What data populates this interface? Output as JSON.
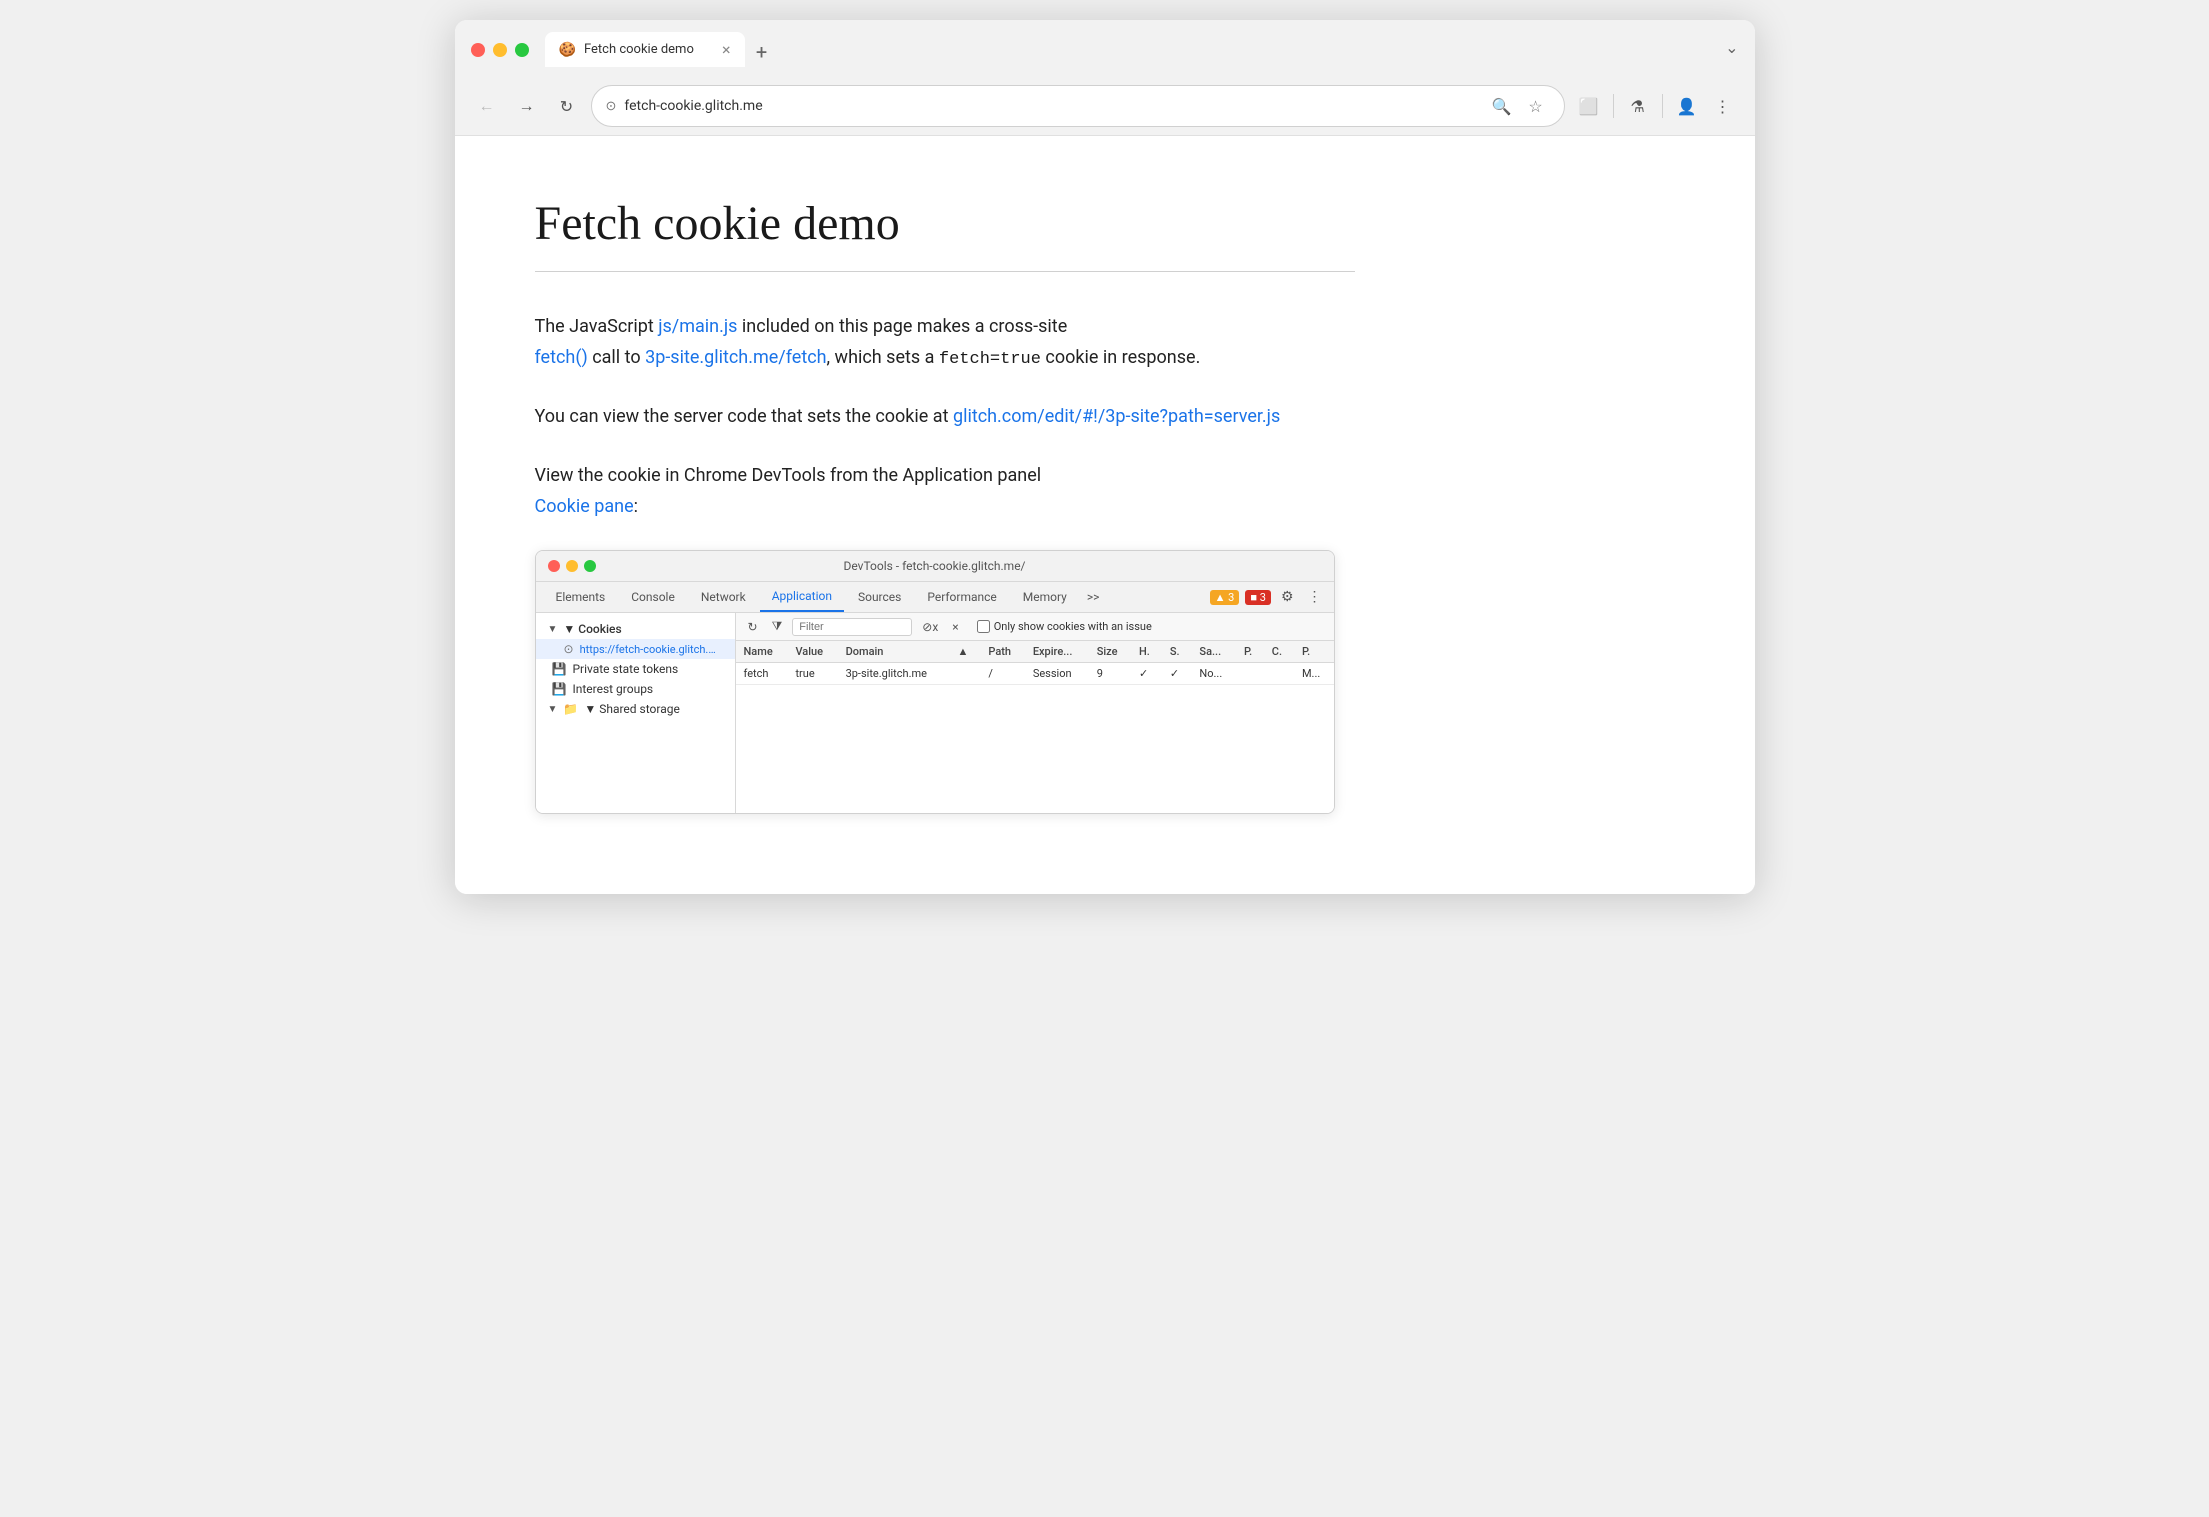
{
  "browser": {
    "tab_favicon": "🍪",
    "tab_title": "Fetch cookie demo",
    "tab_close": "×",
    "new_tab": "+",
    "chevron": "⌄",
    "back_arrow": "←",
    "forward_arrow": "→",
    "reload": "↻",
    "address_icon": "⊙",
    "address_url": "fetch-cookie.glitch.me",
    "search_icon": "🔍",
    "star_icon": "☆",
    "extensions_icon": "⬜",
    "lab_icon": "⚗",
    "profile_icon": "👤",
    "menu_icon": "⋮"
  },
  "page": {
    "title": "Fetch cookie demo",
    "intro_text_before_link": "The JavaScript ",
    "js_link_text": "js/main.js",
    "intro_text_after_link": " included on this page makes a cross-site",
    "fetch_link_text": "fetch()",
    "fetch_middle": " call to ",
    "site_link_text": "3p-site.glitch.me/fetch",
    "fetch_after": ", which sets a ",
    "fetch_code": "fetch=true",
    "fetch_end": " cookie in response.",
    "server_before": "You can view the server code that sets the cookie at ",
    "server_link_text": "glitch.com/edit/#!/3p-site?path=server.js",
    "view_text": "View the cookie in Chrome DevTools from the Application panel",
    "cookie_pane_link": "Cookie pane",
    "cookie_pane_end": ":"
  },
  "devtools": {
    "title": "DevTools - fetch-cookie.glitch.me/",
    "tabs": [
      "Elements",
      "Console",
      "Network",
      "Application",
      "Sources",
      "Performance",
      "Memory",
      ">>"
    ],
    "active_tab": "Application",
    "alert_triangle": "▲ 3",
    "alert_rect": "■ 3",
    "sidebar": {
      "cookies_label": "▼ Cookies",
      "cookies_sub": "https://fetch-cookie.glitch.me",
      "private_state": "Private state tokens",
      "interest_groups": "Interest groups",
      "shared_storage": "▼ Shared storage"
    },
    "toolbar": {
      "refresh": "↻",
      "filter_label": "Filter",
      "fx_btn": "⊘x",
      "clear_btn": "×",
      "only_issues_label": "Only show cookies with an issue"
    },
    "table": {
      "headers": [
        "Name",
        "Value",
        "Domain",
        "▲",
        "Path",
        "Expire...",
        "Size",
        "H.",
        "S.",
        "Sa...",
        "P.",
        "C.",
        "P."
      ],
      "row": {
        "name": "fetch",
        "value": "true",
        "domain": "3p-site.glitch.me",
        "sort": "",
        "path": "/",
        "expires": "Session",
        "size": "9",
        "h": "✓",
        "s": "✓",
        "sa": "No...",
        "p": "",
        "c": "",
        "p2": "M..."
      }
    }
  }
}
